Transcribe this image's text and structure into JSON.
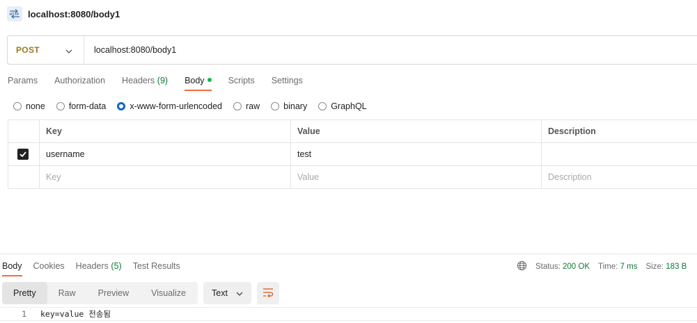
{
  "app": {
    "title": "localhost:8080/body1",
    "icon": "http-request-icon"
  },
  "request": {
    "method": "POST",
    "url": "localhost:8080/body1",
    "method_color": "#a0761f"
  },
  "request_tabs": [
    {
      "label": "Params"
    },
    {
      "label": "Authorization"
    },
    {
      "label": "Headers",
      "count": "(9)"
    },
    {
      "label": "Body",
      "active": true,
      "dot_color": "#0cbb52"
    },
    {
      "label": "Scripts"
    },
    {
      "label": "Settings"
    }
  ],
  "body_types": [
    {
      "label": "none",
      "checked": false
    },
    {
      "label": "form-data",
      "checked": false
    },
    {
      "label": "x-www-form-urlencoded",
      "checked": true
    },
    {
      "label": "raw",
      "checked": false
    },
    {
      "label": "binary",
      "checked": false
    },
    {
      "label": "GraphQL",
      "checked": false
    }
  ],
  "params_table": {
    "headers": {
      "key": "Key",
      "value": "Value",
      "description": "Description"
    },
    "rows": [
      {
        "checked": true,
        "key": "username",
        "value": "test",
        "description": ""
      }
    ],
    "placeholders": {
      "key": "Key",
      "value": "Value",
      "description": "Description"
    }
  },
  "response_tabs": [
    {
      "label": "Body",
      "active": true
    },
    {
      "label": "Cookies"
    },
    {
      "label": "Headers",
      "count": "(5)"
    },
    {
      "label": "Test Results"
    }
  ],
  "status": {
    "status_label": "Status:",
    "status_value": "200 OK",
    "time_label": "Time:",
    "time_value": "7 ms",
    "size_label": "Size:",
    "size_value": "183 B"
  },
  "view_tabs": [
    {
      "label": "Pretty",
      "active": true
    },
    {
      "label": "Raw"
    },
    {
      "label": "Preview"
    },
    {
      "label": "Visualize"
    }
  ],
  "format": {
    "selected": "Text"
  },
  "response_body": {
    "lines": [
      {
        "no": "1",
        "text": "key=value 전송됨"
      }
    ]
  },
  "colors": {
    "accent": "#f26b3a",
    "success": "#0a7a32",
    "radio_checked": "#1166cc",
    "wrap_icon": "#e0531e"
  }
}
